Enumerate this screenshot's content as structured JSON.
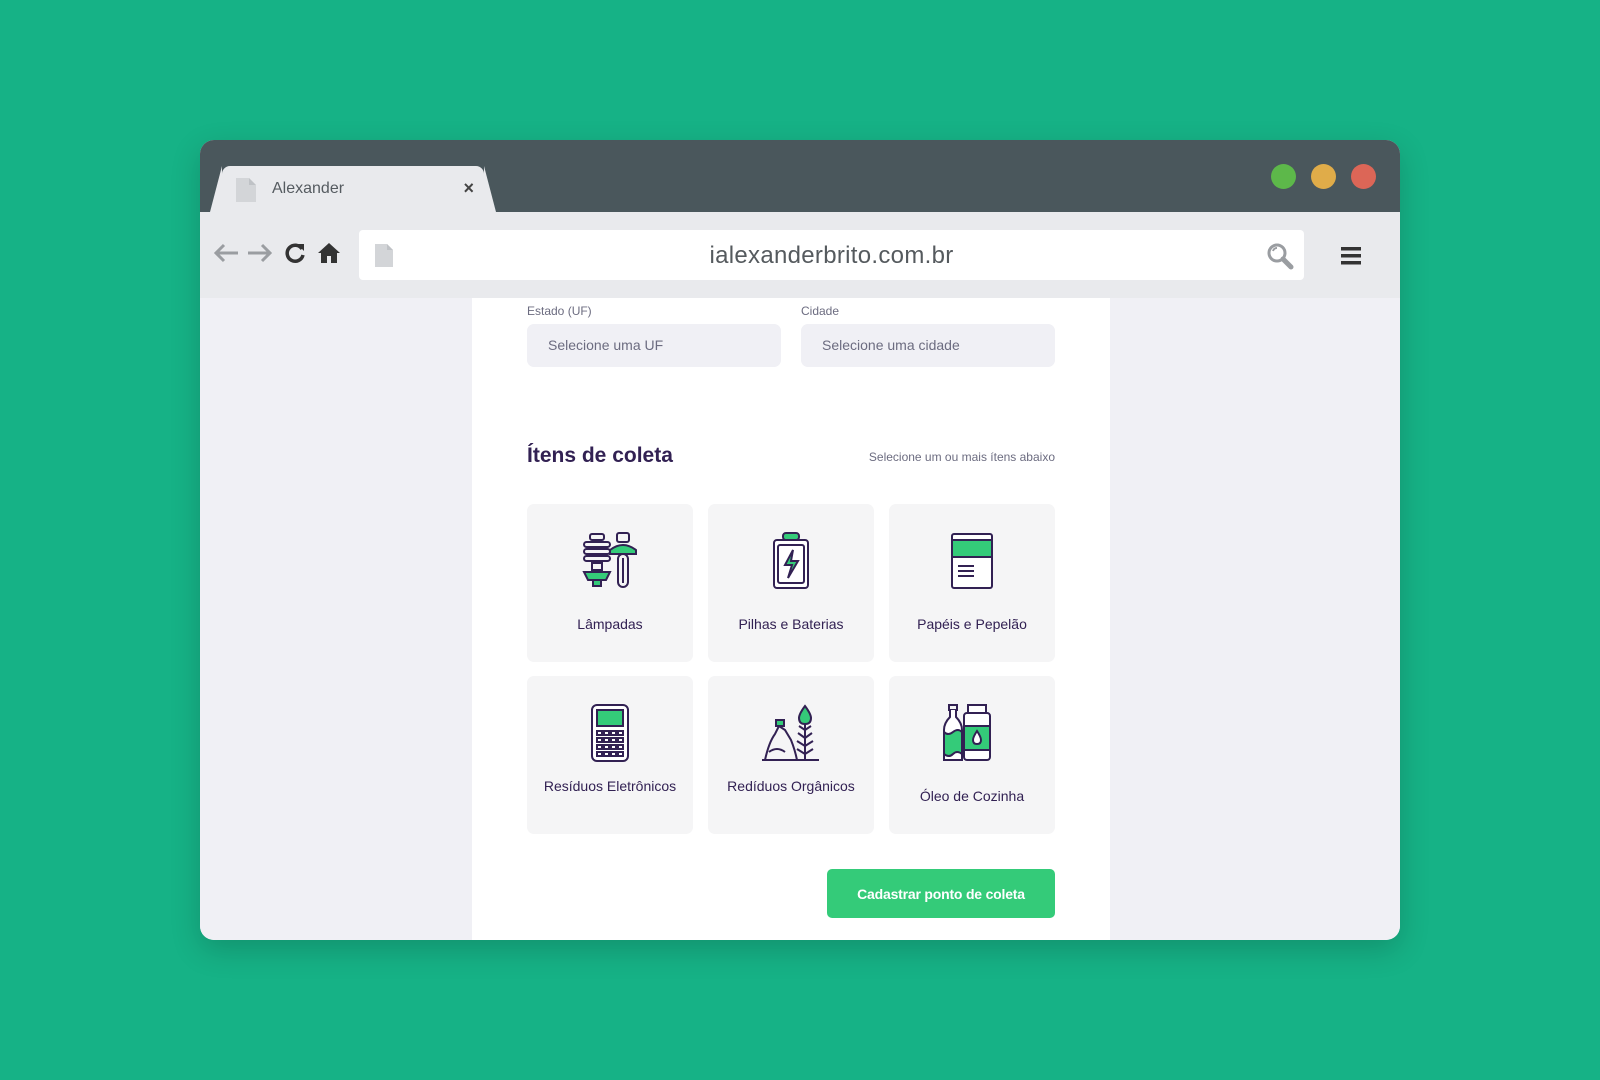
{
  "tab": {
    "title": "Alexander",
    "close": "×"
  },
  "address": {
    "url": "ialexanderbrito.com.br"
  },
  "colors": {
    "background": "#16b286",
    "accent": "#34cb79",
    "heading": "#322153",
    "muted": "#6c6c80"
  },
  "form": {
    "state_label": "Estado (UF)",
    "state_placeholder": "Selecione uma UF",
    "city_label": "Cidade",
    "city_placeholder": "Selecione uma cidade"
  },
  "items_section": {
    "title": "Ítens de coleta",
    "hint": "Selecione um ou mais ítens abaixo",
    "items": [
      {
        "label": "Lâmpadas",
        "icon": "lamps-icon"
      },
      {
        "label": "Pilhas e Baterias",
        "icon": "battery-icon"
      },
      {
        "label": "Papéis e Pepelão",
        "icon": "paper-icon"
      },
      {
        "label": "Resíduos Eletrônicos",
        "icon": "electronics-icon"
      },
      {
        "label": "Redíduos Orgânicos",
        "icon": "organic-icon"
      },
      {
        "label": "Óleo de Cozinha",
        "icon": "oil-icon"
      }
    ]
  },
  "submit_label": "Cadastrar ponto de coleta"
}
